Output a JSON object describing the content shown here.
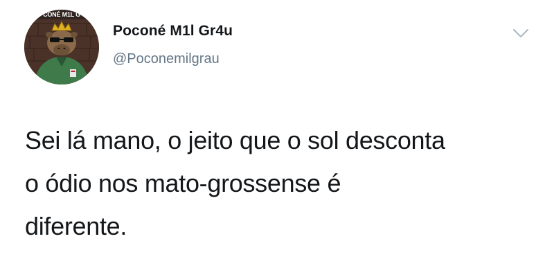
{
  "tweet": {
    "avatar": {
      "badge_text": "CONÉ M1L G",
      "icon": "capybara-avatar-icon"
    },
    "display_name": "Poconé M1l Gr4u",
    "handle": "@Poconemilgrau",
    "menu_icon": "chevron-down-icon",
    "text_lines": [
      "Sei lá mano, o jeito que o sol desconta",
      "o ódio nos mato-grossense é",
      "diferente."
    ]
  },
  "colors": {
    "text_primary": "#14171a",
    "text_secondary": "#657786",
    "chevron": "#aab8c2",
    "background": "#ffffff"
  }
}
